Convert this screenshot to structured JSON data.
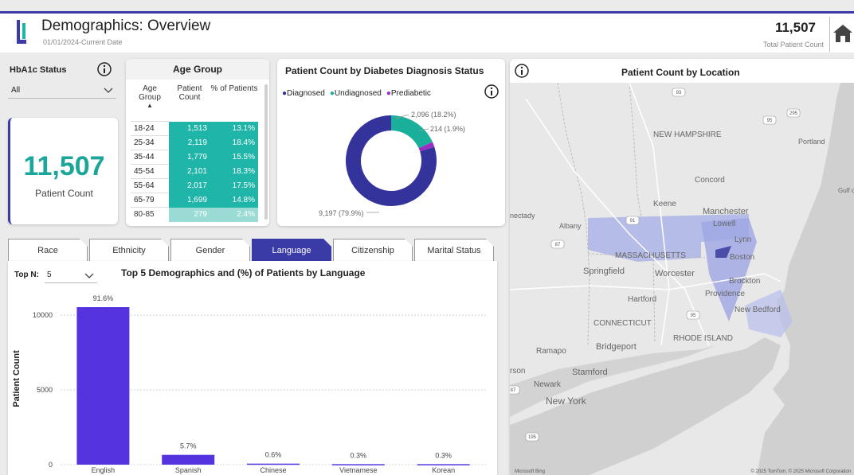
{
  "header": {
    "title": "Demographics: Overview",
    "subtitle": "01/01/2024-Current Date",
    "total_count": "11,507",
    "total_label": "Total Patient Count"
  },
  "hba1c": {
    "label": "HbA1c Status",
    "value": "All"
  },
  "kpi": {
    "value": "11,507",
    "label": "Patient Count"
  },
  "age_group": {
    "title": "Age Group",
    "headers": [
      "Age Group",
      "Patient Count",
      "% of Patients"
    ],
    "rows": [
      [
        "18-24",
        "1,513",
        "13.1%"
      ],
      [
        "25-34",
        "2,119",
        "18.4%"
      ],
      [
        "35-44",
        "1,779",
        "15.5%"
      ],
      [
        "45-54",
        "2,101",
        "18.3%"
      ],
      [
        "55-64",
        "2,017",
        "17.5%"
      ],
      [
        "65-79",
        "1,699",
        "14.8%"
      ],
      [
        "80-85",
        "279",
        "2.4%"
      ]
    ]
  },
  "donut": {
    "title": "Patient Count by Diabetes Diagnosis Status",
    "legend": [
      {
        "label": "Diagnosed",
        "color": "#34339b"
      },
      {
        "label": "Undiagnosed",
        "color": "#1aaf9b"
      },
      {
        "label": "Prediabetic",
        "color": "#9b2fc4"
      }
    ],
    "labels": {
      "diagnosed": "9,197 (79.9%)",
      "undiagnosed": "2,096 (18.2%)",
      "prediabetic": "214 (1.9%)"
    }
  },
  "tabs": [
    "Race",
    "Ethnicity",
    "Gender",
    "Language",
    "Citizenship",
    "Marital Status"
  ],
  "active_tab": "Language",
  "topn": {
    "label": "Top N:",
    "value": "5"
  },
  "map": {
    "title": "Patient Count by Location",
    "places": [
      "NEW HAMPSHIRE",
      "Portland",
      "Gulf of",
      "Concord",
      "Keene",
      "Manchester",
      "Lowell",
      "Lynn",
      "nectady",
      "Albany",
      "MASSACHUSETTS",
      "Boston",
      "Springfield",
      "Worcester",
      "Brockton",
      "Hartford",
      "Providence",
      "New Bedford",
      "CONNECTICUT",
      "RHODE ISLAND",
      "Bridgeport",
      "Ramapo",
      "Stamford",
      "Newark",
      "rson",
      "New York"
    ],
    "road_shields": [
      "93",
      "95",
      "295",
      "91",
      "87",
      "95",
      "195",
      "87"
    ],
    "credit_left": "Microsoft Bing",
    "credit_right": "© 2025 TomTom, © 2025 Microsoft Corporation"
  },
  "chart_data": {
    "type": "bar",
    "title": "Top 5 Demographics and (%) of Patients by Language",
    "ylabel": "Patient Count",
    "xlabel": "",
    "ylim": [
      0,
      11500
    ],
    "yticks": [
      0,
      5000,
      10000
    ],
    "ytick_labels": [
      "0",
      "5000",
      "10000"
    ],
    "categories": [
      "English",
      "Spanish",
      "Chinese",
      "Vietnamese",
      "Korean"
    ],
    "values": [
      10540,
      656,
      69,
      35,
      35
    ],
    "data_labels": [
      "91.6%",
      "5.7%",
      "0.6%",
      "0.3%",
      "0.3%"
    ],
    "color": "#5534e0"
  },
  "donut_data": {
    "type": "pie",
    "categories": [
      "Diagnosed",
      "Undiagnosed",
      "Prediabetic"
    ],
    "values": [
      9197,
      2096,
      214
    ]
  }
}
